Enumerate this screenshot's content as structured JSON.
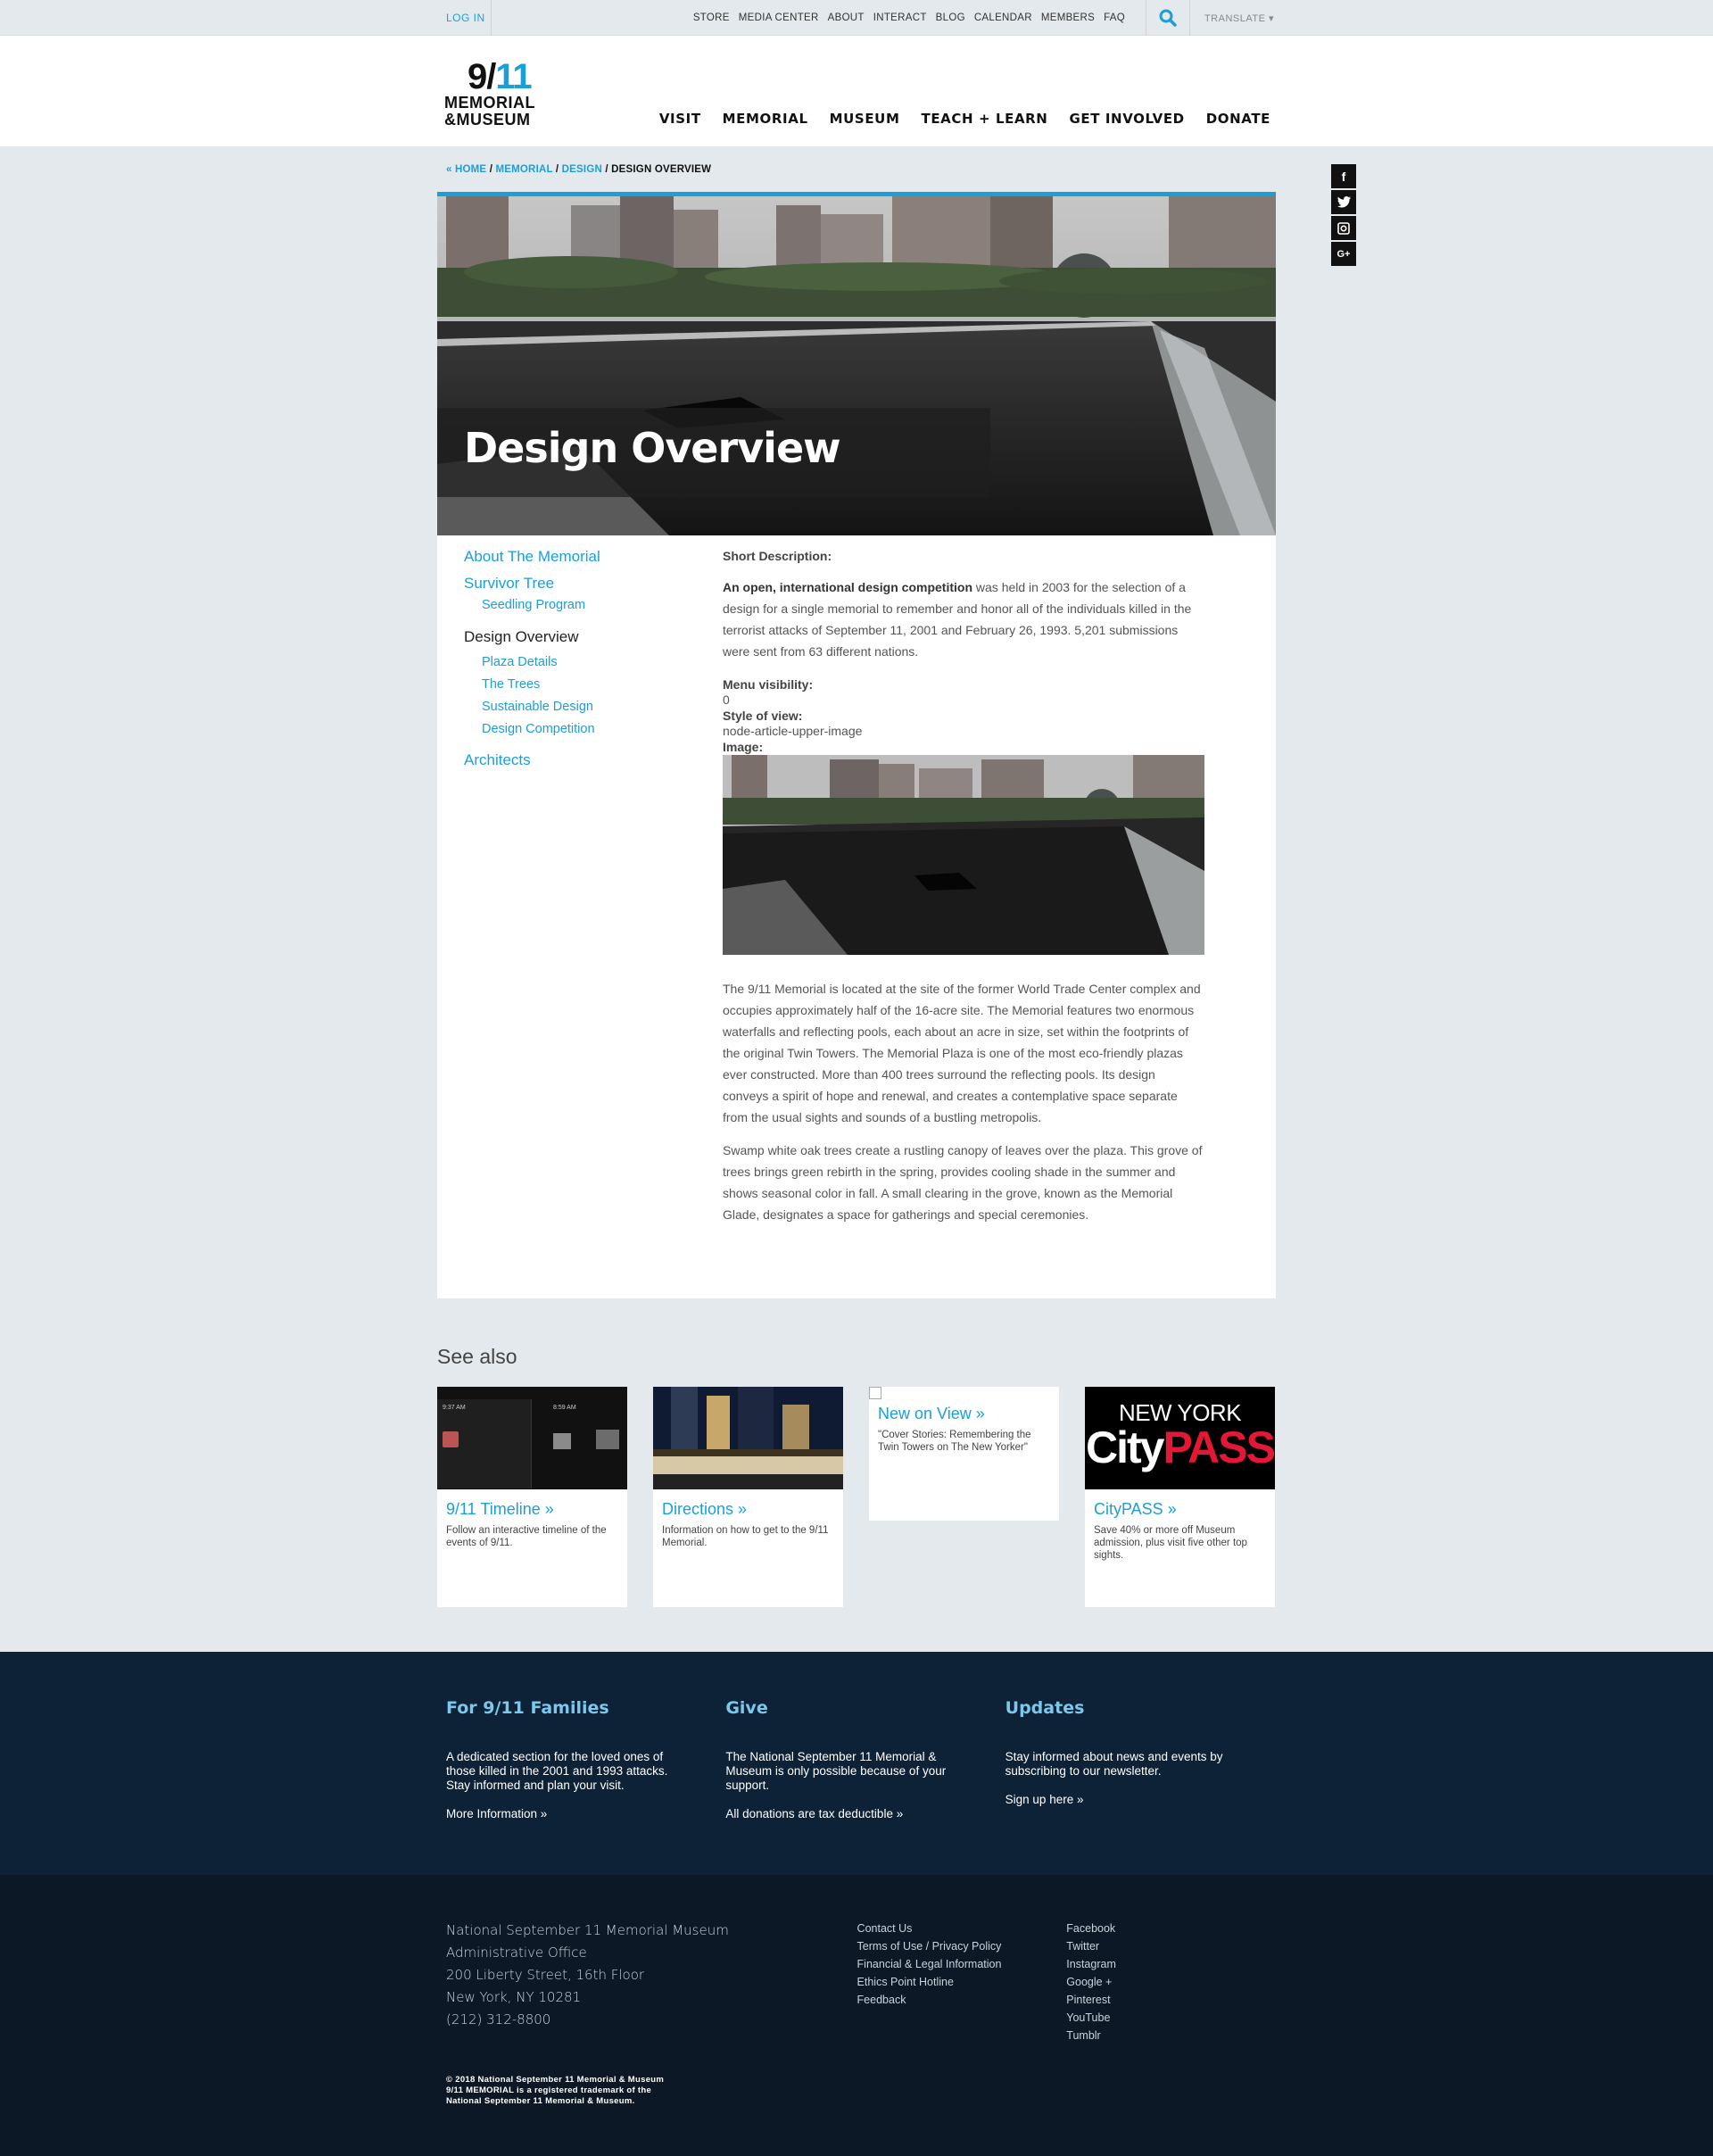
{
  "util_bar": {
    "login": "LOG IN",
    "links": [
      "STORE",
      "MEDIA CENTER",
      "ABOUT",
      "INTERACT",
      "BLOG",
      "CALENDAR",
      "MEMBERS",
      "FAQ"
    ],
    "translate": "TRANSLATE ▾"
  },
  "logo": {
    "number_left": "9/",
    "number_right": "11",
    "line1": "MEMORIAL",
    "line2": "&MUSEUM"
  },
  "main_nav": [
    "VISIT",
    "MEMORIAL",
    "MUSEUM",
    "TEACH + LEARN",
    "GET INVOLVED",
    "DONATE"
  ],
  "breadcrumb": {
    "home": "« HOME",
    "memorial": "MEMORIAL",
    "design": "DESIGN",
    "current": "DESIGN OVERVIEW",
    "sep": " / "
  },
  "social": [
    "f",
    "t",
    "ig",
    "G+"
  ],
  "hero": {
    "title": "Design Overview"
  },
  "sidenav": {
    "about": "About The Memorial",
    "survivor_tree": "Survivor Tree",
    "seedling": "Seedling Program",
    "design_overview": "Design Overview",
    "plaza": "Plaza Details",
    "trees": "The Trees",
    "sustainable": "Sustainable Design",
    "competition": "Design Competition",
    "architects": "Architects"
  },
  "article": {
    "short_desc_label": "Short Description:",
    "intro_bold": "An open, international design competition",
    "intro_rest": " was held in 2003 for the selection of a design for a single memorial to remember and honor all of the individuals killed in the terrorist attacks of September 11, 2001 and February 26, 1993. 5,201 submissions were sent from 63 different nations.",
    "menu_vis_label": "Menu visibility:",
    "menu_vis_value": "0",
    "style_label": "Style of view:",
    "style_value": "node-article-upper-image",
    "image_label": "Image:",
    "para1": "The 9/11 Memorial is located at the site of the former World Trade Center complex and occupies approximately half of the 16-acre site. The Memorial features two enormous waterfalls and reflecting pools, each about an acre in size, set within the footprints of the original Twin Towers. The Memorial Plaza is one of the most eco-friendly plazas ever constructed. More than 400 trees surround the reflecting pools. Its design conveys a spirit of hope and renewal, and creates a contemplative space separate from the usual sights and sounds of a bustling metropolis.",
    "para2": "Swamp white oak trees create a rustling canopy of leaves over the plaza. This grove of trees brings green rebirth in the spring, provides cooling shade in the summer and shows seasonal color in fall. A small clearing in the grove, known as the Memorial Glade, designates a space for gatherings and special ceremonies."
  },
  "see_also": {
    "title": "See also",
    "cards": [
      {
        "title": "9/11 Timeline »",
        "desc": "Follow an interactive timeline of the events of 9/11."
      },
      {
        "title": "Directions »",
        "desc": "Information on how to get to the 9/11 Memorial."
      },
      {
        "title": "New on View »",
        "desc": "\"Cover Stories: Remembering the Twin Towers on The New Yorker\""
      },
      {
        "title": "CityPASS »",
        "desc": "Save 40% or more off Museum admission, plus visit five other top sights."
      }
    ],
    "timeline_thumb": {
      "time1": "9:37 AM",
      "time2": "8:59 AM"
    },
    "citypass_thumb": {
      "line1": "NEW YORK",
      "city": "City",
      "pass": "PASS"
    }
  },
  "band": {
    "families": {
      "title": "For 9/11 Families",
      "text": "A dedicated section for the loved ones of those killed in the 2001 and 1993 attacks. Stay informed and plan your visit.",
      "link": "More Information »"
    },
    "give": {
      "title": "Give",
      "text": "The National September 11 Memorial & Museum is only possible because of your support.",
      "link": "All donations are tax deductible »"
    },
    "updates": {
      "title": "Updates",
      "text": "Stay informed about news and events by subscribing to our newsletter.",
      "link": "Sign up here »"
    }
  },
  "footer": {
    "address": [
      "National September 11 Memorial Museum",
      "Administrative Office",
      "200 Liberty Street, 16th Floor",
      "New York, NY 10281",
      "(212) 312-8800"
    ],
    "links": [
      "Contact Us",
      "Terms of Use / Privacy Policy",
      "Financial & Legal Information",
      "Ethics Point Hotline",
      "Feedback"
    ],
    "social_links": [
      "Facebook",
      "Twitter",
      "Instagram",
      "Google +",
      "Pinterest",
      "YouTube",
      "Tumblr"
    ],
    "copyright": [
      "© 2018 National September 11 Memorial & Museum",
      "9/11 MEMORIAL is a registered trademark of the",
      "National September 11 Memorial & Museum."
    ]
  },
  "colors": {
    "accent": "#1b9fd9",
    "band": "#0d2237",
    "footer": "#0c1825",
    "page_bg": "#e3e9ec"
  }
}
